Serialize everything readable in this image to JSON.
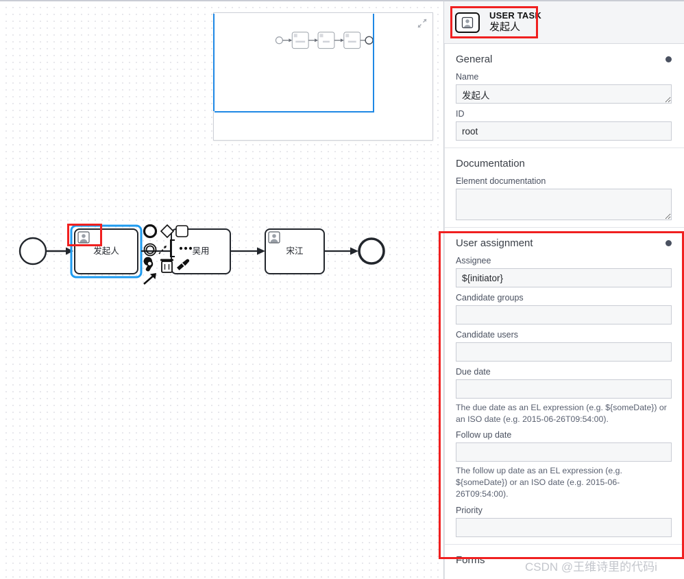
{
  "header": {
    "type_label": "USER TASK",
    "element_name": "发起人",
    "icon": "user-task-icon"
  },
  "canvas": {
    "minimap": {
      "toggle_icon": "collapse-diagonal-arrows-icon",
      "viewport_color": "#1e88e5"
    },
    "nodes": [
      {
        "id": "start",
        "type": "start-event",
        "label": ""
      },
      {
        "id": "task1",
        "type": "user-task",
        "label": "发起人",
        "selected": true
      },
      {
        "id": "task2",
        "type": "task",
        "label": "吴用"
      },
      {
        "id": "task3",
        "type": "user-task",
        "label": "宋江"
      },
      {
        "id": "end",
        "type": "end-event",
        "label": ""
      }
    ],
    "context_pad": [
      {
        "name": "append-end-event-icon",
        "glyph": "circle-thick"
      },
      {
        "name": "append-gateway-icon",
        "glyph": "diamond"
      },
      {
        "name": "append-task-icon",
        "glyph": "rounded-square"
      },
      {
        "name": "append-intermediate-event-icon",
        "glyph": "double-circle"
      },
      {
        "name": "connect-icon",
        "glyph": "dashed-arrow"
      },
      {
        "name": "append-text-annotation-icon",
        "glyph": "bracket"
      },
      {
        "name": "more-options-icon",
        "glyph": "ellipsis"
      },
      {
        "name": "change-type-wrench-icon",
        "glyph": "wrench"
      },
      {
        "name": "delete-icon",
        "glyph": "trash"
      },
      {
        "name": "set-color-icon",
        "glyph": "paintbrush"
      },
      {
        "name": "connect-arrow-icon",
        "glyph": "arrow-up-right"
      }
    ],
    "annotation_color": "#f02020"
  },
  "panel": {
    "general": {
      "title": "General",
      "name_label": "Name",
      "name_value": "发起人",
      "id_label": "ID",
      "id_value": "root"
    },
    "documentation": {
      "title": "Documentation",
      "element_doc_label": "Element documentation",
      "element_doc_value": ""
    },
    "user_assignment": {
      "title": "User assignment",
      "assignee_label": "Assignee",
      "assignee_value": "${initiator}",
      "candidate_groups_label": "Candidate groups",
      "candidate_groups_value": "",
      "candidate_users_label": "Candidate users",
      "candidate_users_value": "",
      "due_date_label": "Due date",
      "due_date_value": "",
      "due_date_hint": "The due date as an EL expression (e.g. ${someDate}) or an ISO date (e.g. 2015-06-26T09:54:00).",
      "follow_up_date_label": "Follow up date",
      "follow_up_date_value": "",
      "follow_up_date_hint": "The follow up date as an EL expression (e.g. ${someDate}) or an ISO date (e.g. 2015-06-26T09:54:00).",
      "priority_label": "Priority",
      "priority_value": ""
    },
    "forms": {
      "title": "Forms"
    }
  },
  "watermark": {
    "text": "CSDN @王维诗里的代码i"
  }
}
